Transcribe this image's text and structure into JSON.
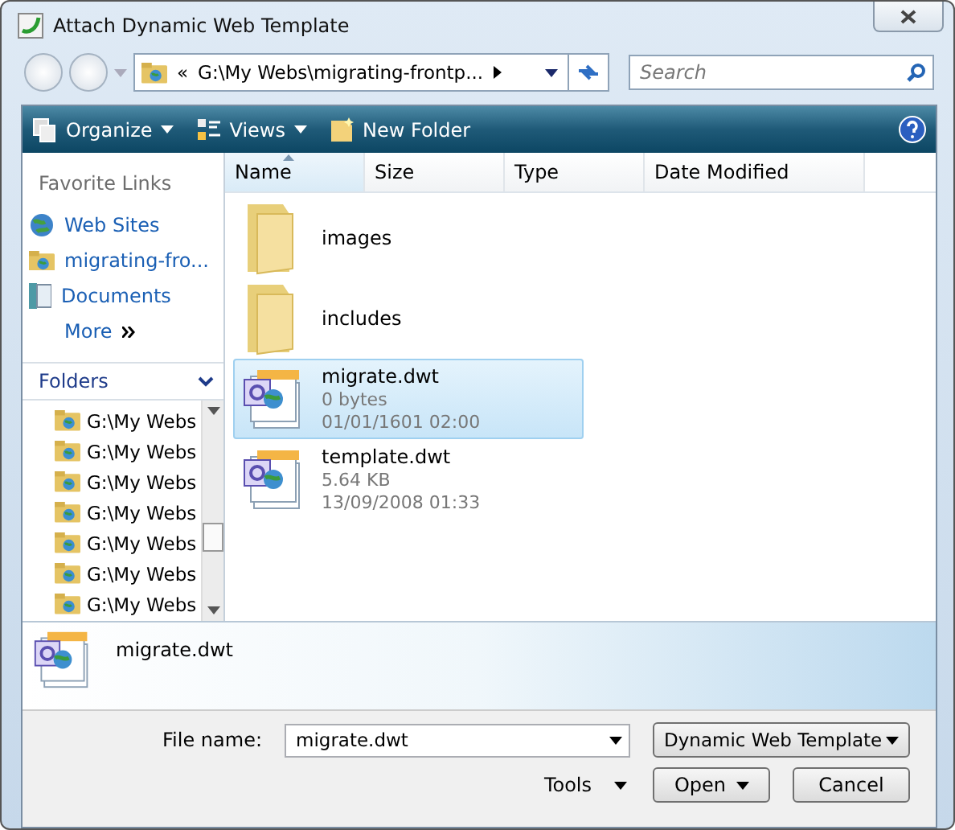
{
  "window": {
    "title": "Attach Dynamic Web Template"
  },
  "address": {
    "path": "G:\\My Webs\\migrating-frontp...",
    "prefix": "«"
  },
  "search": {
    "placeholder": "Search"
  },
  "toolbar": [
    {
      "label": "Organize",
      "kind": "menu"
    },
    {
      "label": "Views",
      "kind": "menu"
    },
    {
      "label": "New Folder",
      "kind": "plain"
    }
  ],
  "favorite_links": {
    "title": "Favorite Links",
    "items": [
      {
        "label": "Web Sites",
        "kind": "globe"
      },
      {
        "label": "migrating-fro...",
        "kind": "webfolder"
      },
      {
        "label": "Documents",
        "kind": "docs"
      },
      {
        "label": "More",
        "kind": "more"
      }
    ]
  },
  "folders": {
    "title": "Folders",
    "expanded": true,
    "items": [
      "G:\\My Webs",
      "G:\\My Webs",
      "G:\\My Webs",
      "G:\\My Webs",
      "G:\\My Webs",
      "G:\\My Webs",
      "G:\\My Webs"
    ]
  },
  "columns": [
    {
      "label": "Name",
      "sorted": true
    },
    {
      "label": "Size",
      "sorted": false
    },
    {
      "label": "Type",
      "sorted": false
    },
    {
      "label": "Date Modified",
      "sorted": false
    }
  ],
  "files": [
    {
      "kind": "folder",
      "name": "images",
      "selected": false
    },
    {
      "kind": "folder",
      "name": "includes",
      "selected": false
    },
    {
      "kind": "file",
      "name": "migrate.dwt",
      "size": "0 bytes",
      "date": "01/01/1601 02:00",
      "selected": true
    },
    {
      "kind": "file",
      "name": "template.dwt",
      "size": "5.64 KB",
      "date": "13/09/2008 01:33",
      "selected": false
    }
  ],
  "details": {
    "name": "migrate.dwt"
  },
  "file_name": {
    "label": "File name:",
    "value": "migrate.dwt"
  },
  "file_type": {
    "value": "Dynamic Web Template"
  },
  "tools": {
    "label": "Tools"
  },
  "buttons": [
    {
      "label": "Open",
      "kind": "split"
    },
    {
      "label": "Cancel",
      "kind": "plain"
    }
  ]
}
